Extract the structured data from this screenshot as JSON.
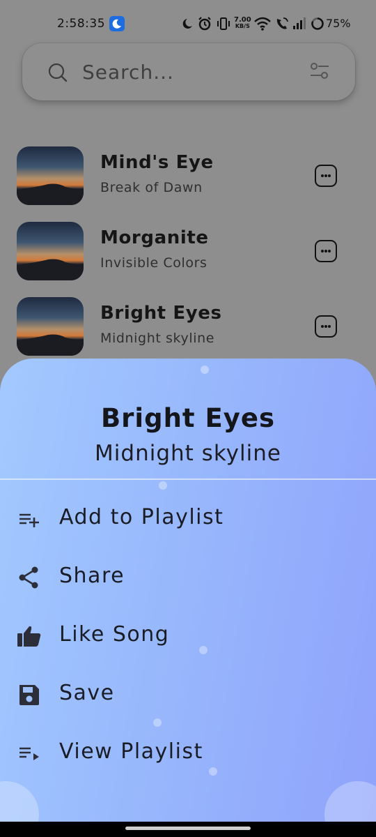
{
  "status_bar": {
    "time": "2:58:35",
    "net_speed_value": "7.00",
    "net_speed_unit": "KB/S",
    "battery": "75%"
  },
  "search": {
    "placeholder": "Search..."
  },
  "songs": [
    {
      "title": "Mind's Eye",
      "artist": "Break of Dawn"
    },
    {
      "title": "Morganite",
      "artist": "Invisible Colors"
    },
    {
      "title": "Bright Eyes",
      "artist": "Midnight skyline"
    }
  ],
  "sheet": {
    "title": "Bright Eyes",
    "subtitle": "Midnight skyline",
    "menu": [
      {
        "label": "Add to Playlist",
        "icon": "playlist-add-icon"
      },
      {
        "label": "Share",
        "icon": "share-icon"
      },
      {
        "label": "Like Song",
        "icon": "thumb-up-icon"
      },
      {
        "label": "Save",
        "icon": "save-icon"
      },
      {
        "label": "View Playlist",
        "icon": "playlist-play-icon"
      }
    ]
  },
  "colors": {
    "sheet_gradient_start": "#a3c9ff",
    "sheet_gradient_end": "#8fa3fb",
    "dim_background": "#8e8e8e"
  }
}
